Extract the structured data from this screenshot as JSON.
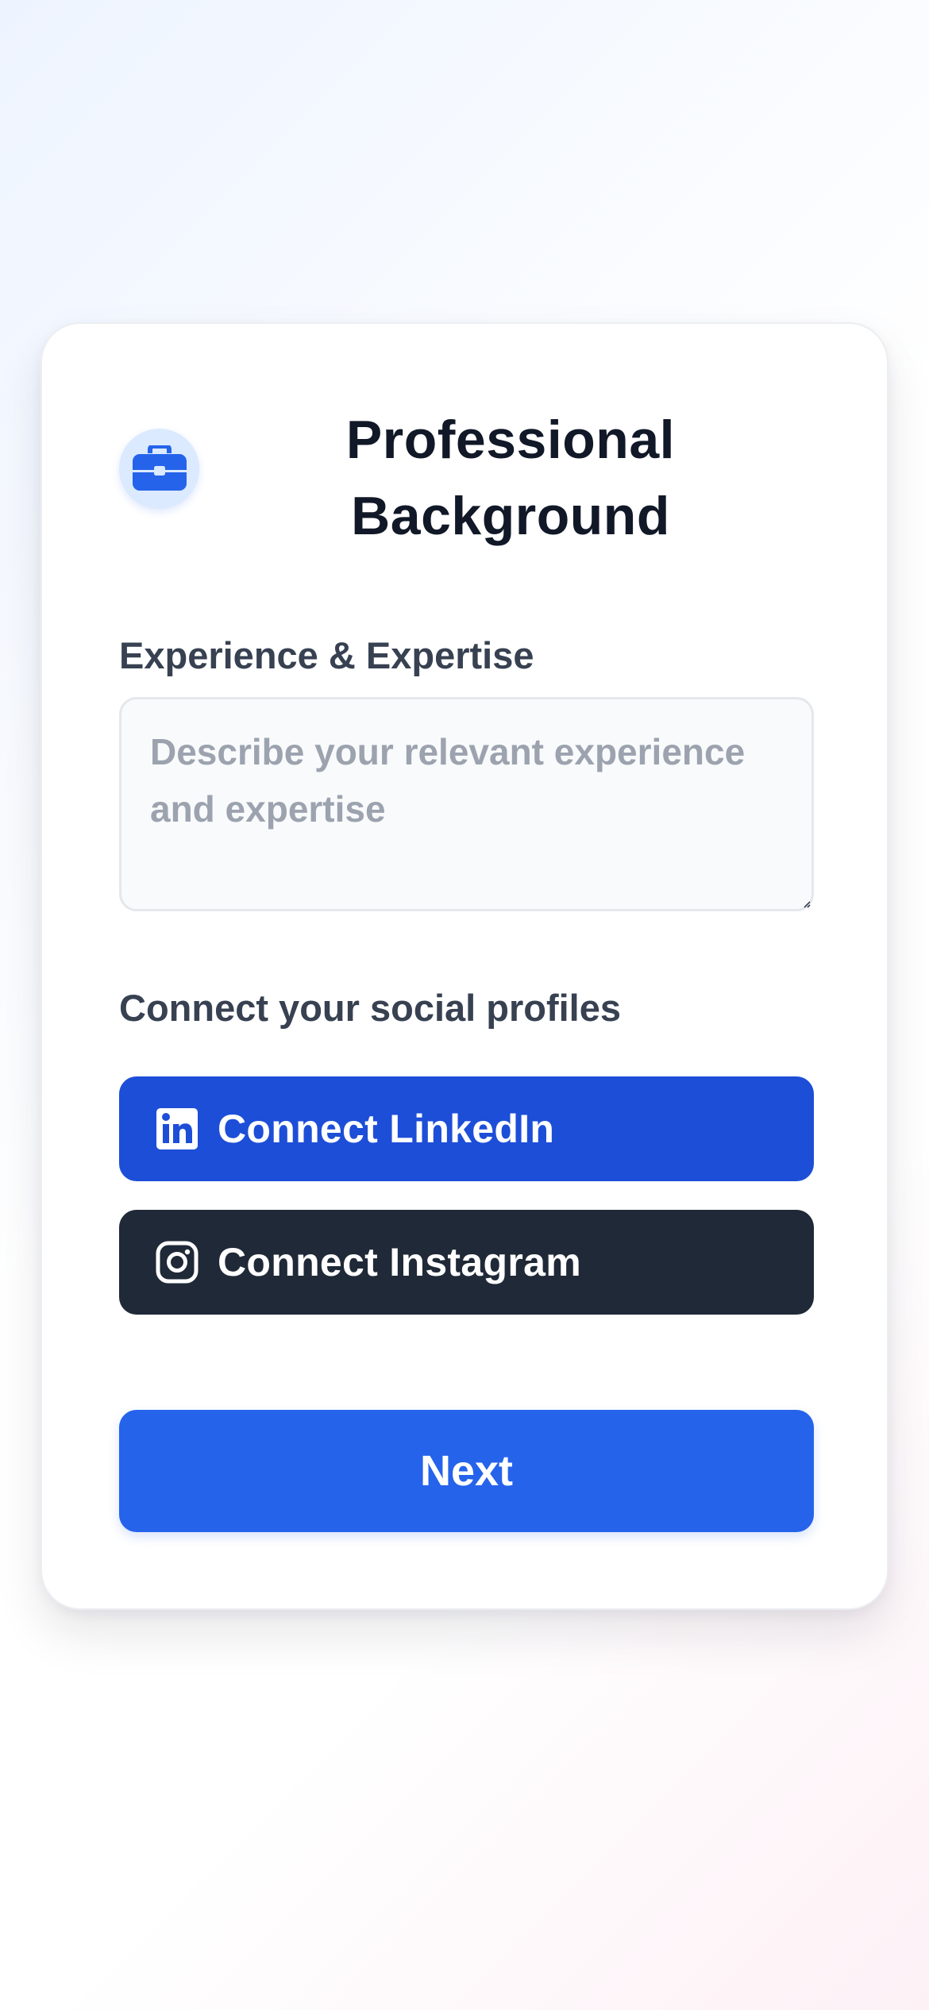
{
  "card": {
    "title": "Professional Background",
    "header_icon": "briefcase-icon"
  },
  "experience": {
    "label": "Experience & Expertise",
    "value": "",
    "placeholder": "Describe your relevant experience and expertise"
  },
  "social": {
    "heading": "Connect your social profiles",
    "linkedin": {
      "label": "Connect LinkedIn",
      "icon": "linkedin-icon",
      "color": "#1d4ed8"
    },
    "instagram": {
      "label": "Connect Instagram",
      "icon": "instagram-icon",
      "color": "#1f2937"
    }
  },
  "actions": {
    "next_label": "Next",
    "accent": "#2563eb"
  }
}
